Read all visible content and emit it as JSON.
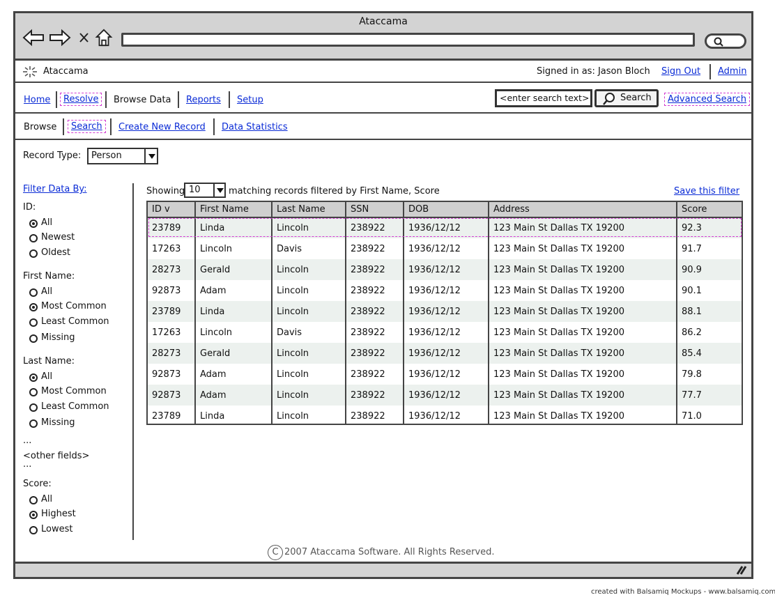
{
  "window": {
    "title": "Ataccama"
  },
  "browser": {
    "url": ""
  },
  "app": {
    "name": "Ataccama",
    "signed_in": "Signed in as: Jason Bloch",
    "sign_out": "Sign Out",
    "admin": "Admin"
  },
  "nav": {
    "home": "Home",
    "resolve": "Resolve",
    "browse_data": "Browse Data",
    "reports": "Reports",
    "setup": "Setup",
    "search_placeholder": "<enter search text>",
    "search_button": "Search",
    "advanced_search": "Advanced Search"
  },
  "subnav": {
    "browse": "Browse",
    "search": "Search",
    "create_new_record": "Create New Record",
    "data_statistics": "Data Statistics"
  },
  "record_type": {
    "label": "Record Type:",
    "value": "Person"
  },
  "filter": {
    "heading": "Filter Data By:",
    "id_label": "ID:",
    "id_options": [
      "All",
      "Newest",
      "Oldest"
    ],
    "first_name_label": "First Name:",
    "first_name_options": [
      "All",
      "Most Common",
      "Least Common",
      "Missing"
    ],
    "last_name_label": "Last Name:",
    "last_name_options": [
      "All",
      "Most Common",
      "Least Common",
      "Missing"
    ],
    "ellipsis": "...",
    "other_fields": "<other fields>",
    "score_label": "Score:",
    "score_options": [
      "All",
      "Highest",
      "Lowest"
    ]
  },
  "results": {
    "showing": "Showing",
    "page_size": "10",
    "matching": "matching records filtered by First Name, Score",
    "save_filter": "Save this filter",
    "columns": [
      "ID v",
      "First Name",
      "Last Name",
      "SSN",
      "DOB",
      "Address",
      "Score"
    ],
    "rows": [
      [
        "23789",
        "Linda",
        "Lincoln",
        "238922",
        "1936/12/12",
        "123 Main St Dallas TX 19200",
        "92.3"
      ],
      [
        "17263",
        "Lincoln",
        "Davis",
        "238922",
        "1936/12/12",
        "123 Main St Dallas TX 19200",
        "91.7"
      ],
      [
        "28273",
        "Gerald",
        "Lincoln",
        "238922",
        "1936/12/12",
        "123 Main St Dallas TX 19200",
        "90.9"
      ],
      [
        "92873",
        "Adam",
        "Lincoln",
        "238922",
        "1936/12/12",
        "123 Main St Dallas TX 19200",
        "90.1"
      ],
      [
        "23789",
        "Linda",
        "Lincoln",
        "238922",
        "1936/12/12",
        "123 Main St Dallas TX 19200",
        "88.1"
      ],
      [
        "17263",
        "Lincoln",
        "Davis",
        "238922",
        "1936/12/12",
        "123 Main St Dallas TX 19200",
        "86.2"
      ],
      [
        "28273",
        "Gerald",
        "Lincoln",
        "238922",
        "1936/12/12",
        "123 Main St Dallas TX 19200",
        "85.4"
      ],
      [
        "92873",
        "Adam",
        "Lincoln",
        "238922",
        "1936/12/12",
        "123 Main St Dallas TX 19200",
        "79.8"
      ],
      [
        "92873",
        "Adam",
        "Lincoln",
        "238922",
        "1936/12/12",
        "123 Main St Dallas TX 19200",
        "77.7"
      ],
      [
        "23789",
        "Linda",
        "Lincoln",
        "238922",
        "1936/12/12",
        "123 Main St Dallas TX 19200",
        "71.0"
      ]
    ]
  },
  "footer": {
    "copyright_symbol": "C",
    "text": "2007 Ataccama Software. All Rights Reserved."
  },
  "credit": "created with Balsamiq Mockups - www.balsamiq.com"
}
